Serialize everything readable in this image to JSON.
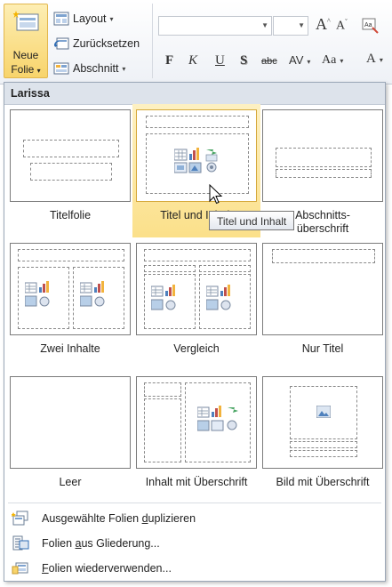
{
  "ribbon": {
    "new_slide": {
      "line1": "Neue",
      "line2": "Folie",
      "arrow": "▾"
    },
    "layout": "Layout",
    "reset": "Zurücksetzen",
    "section": "Abschnitt",
    "grow_font": "A",
    "shrink_font": "A",
    "bold": "F",
    "italic": "K",
    "underline": "U",
    "shadow": "S",
    "strike": "abc",
    "spacing": "AV",
    "case": "Aa",
    "color": "A"
  },
  "gallery": {
    "section_title": "Larissa",
    "layouts": [
      {
        "label": "Titelfolie"
      },
      {
        "label": "Titel und Inhalt",
        "selected": true
      },
      {
        "label_line1": "Abschnitts-",
        "label_line2": "überschrift"
      },
      {
        "label": "Zwei Inhalte"
      },
      {
        "label": "Vergleich"
      },
      {
        "label": "Nur Titel"
      },
      {
        "label": "Leer"
      },
      {
        "label": "Inhalt mit Überschrift"
      },
      {
        "label": "Bild mit Überschrift"
      }
    ],
    "tooltip": "Titel und Inhalt"
  },
  "menu": {
    "duplicate": {
      "pre": "Ausgewählte Folien ",
      "key": "d",
      "post": "uplizieren"
    },
    "outline": {
      "pre": "Folien ",
      "key": "a",
      "post": "us Gliederung..."
    },
    "reuse": {
      "pre": "",
      "key": "F",
      "post": "olien wiederverwenden..."
    }
  },
  "colors": {
    "highlight": "#fbe08a",
    "accent_border": "#d5a83a",
    "section_bg": "#dde3eb"
  }
}
